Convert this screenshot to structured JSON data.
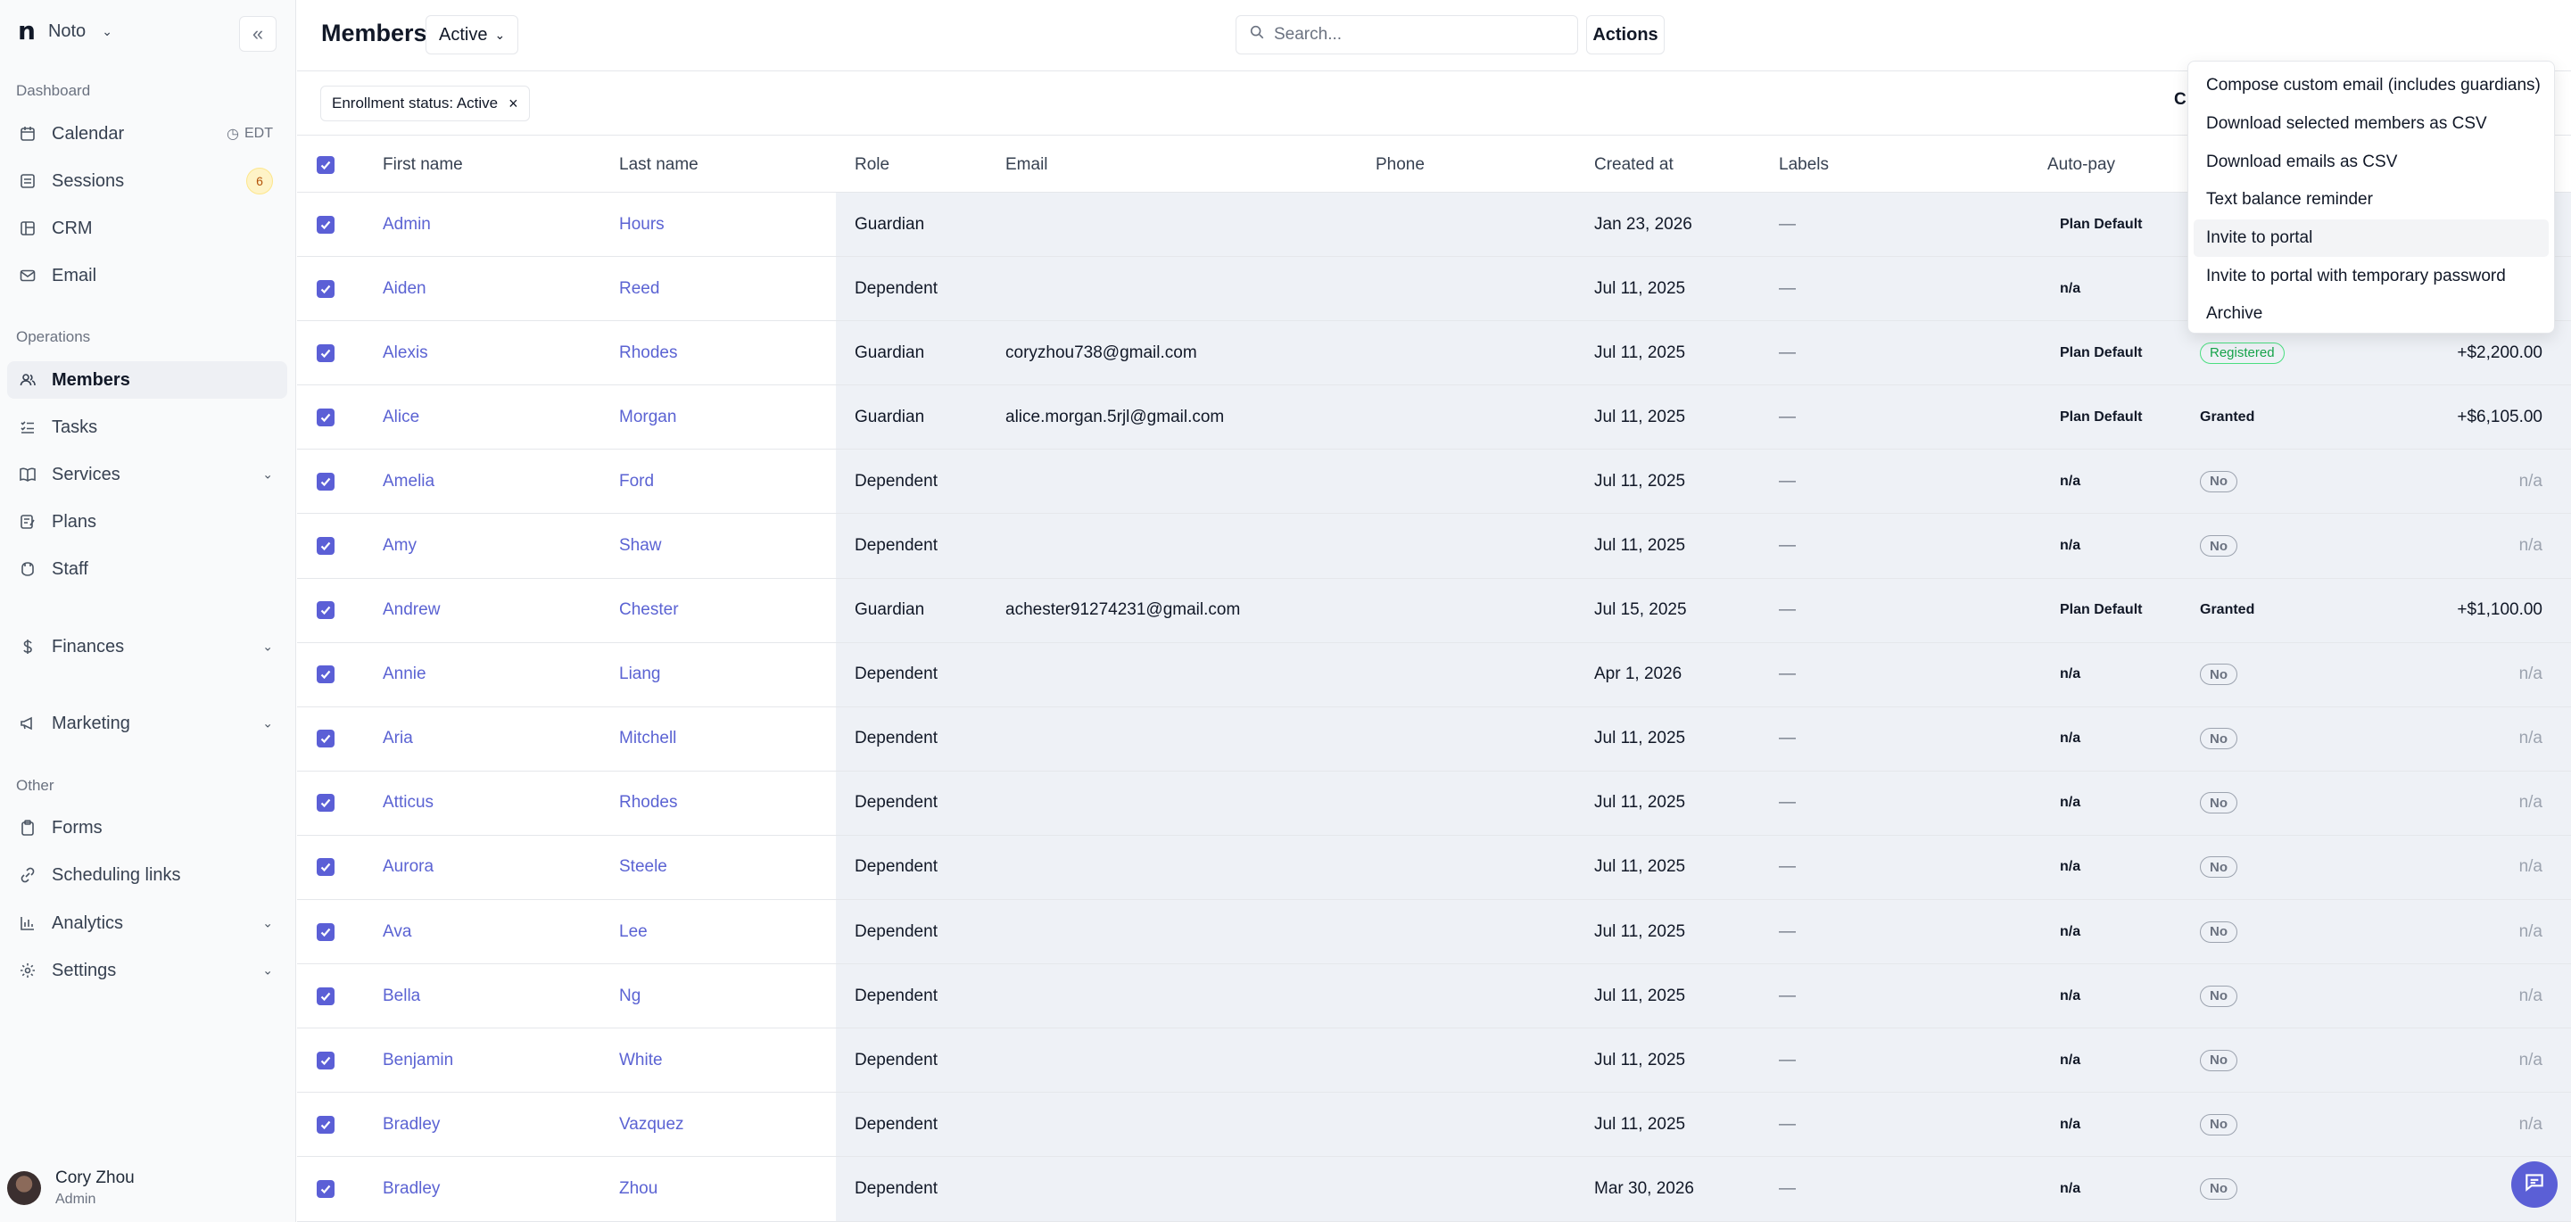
{
  "brand": {
    "logo": "n",
    "name": "Noto"
  },
  "sidebar": {
    "sections": [
      {
        "label": "Dashboard"
      },
      {
        "label": "Operations"
      },
      {
        "label": "Other"
      }
    ],
    "items": [
      {
        "label": "Calendar",
        "icon": "calendar-icon",
        "trail": "EDT"
      },
      {
        "label": "Sessions",
        "icon": "sessions-icon",
        "badge": "6"
      },
      {
        "label": "CRM",
        "icon": "crm-icon"
      },
      {
        "label": "Email",
        "icon": "mail-icon"
      },
      {
        "label": "Members",
        "icon": "users-icon",
        "active": true
      },
      {
        "label": "Tasks",
        "icon": "tasks-icon"
      },
      {
        "label": "Services",
        "icon": "book-icon",
        "expandable": true
      },
      {
        "label": "Plans",
        "icon": "plans-icon"
      },
      {
        "label": "Staff",
        "icon": "staff-icon"
      },
      {
        "label": "Finances",
        "icon": "dollar-icon",
        "expandable": true
      },
      {
        "label": "Marketing",
        "icon": "megaphone-icon",
        "expandable": true
      },
      {
        "label": "Forms",
        "icon": "clipboard-icon"
      },
      {
        "label": "Scheduling links",
        "icon": "link-icon"
      },
      {
        "label": "Analytics",
        "icon": "chart-icon",
        "expandable": true
      },
      {
        "label": "Settings",
        "icon": "gear-icon",
        "expandable": true
      }
    ],
    "user": {
      "name": "Cory Zhou",
      "role": "Admin"
    }
  },
  "header": {
    "title": "Members",
    "status_value": "Active",
    "search_placeholder": "Search...",
    "actions_label": "Actions"
  },
  "filter": {
    "chip": "Enrollment status: Active",
    "clear_label": "Cl"
  },
  "table": {
    "columns": [
      "First name",
      "Last name",
      "Role",
      "Email",
      "Phone",
      "Created at",
      "Labels",
      "Auto-pay"
    ],
    "rows": [
      {
        "first": "Admin",
        "last": "Hours",
        "role": "Guardian",
        "email": "",
        "phone": "",
        "created": "Jan 23, 2026",
        "labels": "—",
        "autopay": "Plan Default",
        "status": "",
        "balance": ""
      },
      {
        "first": "Aiden",
        "last": "Reed",
        "role": "Dependent",
        "email": "",
        "phone": "",
        "created": "Jul 11, 2025",
        "labels": "—",
        "autopay": "n/a",
        "status": "",
        "balance": ""
      },
      {
        "first": "Alexis",
        "last": "Rhodes",
        "role": "Guardian",
        "email": "coryzhou738@gmail.com",
        "phone": "",
        "created": "Jul 11, 2025",
        "labels": "—",
        "autopay": "Plan Default",
        "status": "Registered",
        "balance": "+$2,200.00"
      },
      {
        "first": "Alice",
        "last": "Morgan",
        "role": "Guardian",
        "email": "alice.morgan.5rjl@gmail.com",
        "phone": "",
        "created": "Jul 11, 2025",
        "labels": "—",
        "autopay": "Plan Default",
        "status": "Granted",
        "balance": "+$6,105.00"
      },
      {
        "first": "Amelia",
        "last": "Ford",
        "role": "Dependent",
        "email": "",
        "phone": "",
        "created": "Jul 11, 2025",
        "labels": "—",
        "autopay": "n/a",
        "status": "No",
        "balance": "n/a"
      },
      {
        "first": "Amy",
        "last": "Shaw",
        "role": "Dependent",
        "email": "",
        "phone": "",
        "created": "Jul 11, 2025",
        "labels": "—",
        "autopay": "n/a",
        "status": "No",
        "balance": "n/a"
      },
      {
        "first": "Andrew",
        "last": "Chester",
        "role": "Guardian",
        "email": "achester91274231@gmail.com",
        "phone": "",
        "created": "Jul 15, 2025",
        "labels": "—",
        "autopay": "Plan Default",
        "status": "Granted",
        "balance": "+$1,100.00"
      },
      {
        "first": "Annie",
        "last": "Liang",
        "role": "Dependent",
        "email": "",
        "phone": "",
        "created": "Apr 1, 2026",
        "labels": "—",
        "autopay": "n/a",
        "status": "No",
        "balance": "n/a"
      },
      {
        "first": "Aria",
        "last": "Mitchell",
        "role": "Dependent",
        "email": "",
        "phone": "",
        "created": "Jul 11, 2025",
        "labels": "—",
        "autopay": "n/a",
        "status": "No",
        "balance": "n/a"
      },
      {
        "first": "Atticus",
        "last": "Rhodes",
        "role": "Dependent",
        "email": "",
        "phone": "",
        "created": "Jul 11, 2025",
        "labels": "—",
        "autopay": "n/a",
        "status": "No",
        "balance": "n/a"
      },
      {
        "first": "Aurora",
        "last": "Steele",
        "role": "Dependent",
        "email": "",
        "phone": "",
        "created": "Jul 11, 2025",
        "labels": "—",
        "autopay": "n/a",
        "status": "No",
        "balance": "n/a"
      },
      {
        "first": "Ava",
        "last": "Lee",
        "role": "Dependent",
        "email": "",
        "phone": "",
        "created": "Jul 11, 2025",
        "labels": "—",
        "autopay": "n/a",
        "status": "No",
        "balance": "n/a"
      },
      {
        "first": "Bella",
        "last": "Ng",
        "role": "Dependent",
        "email": "",
        "phone": "",
        "created": "Jul 11, 2025",
        "labels": "—",
        "autopay": "n/a",
        "status": "No",
        "balance": "n/a"
      },
      {
        "first": "Benjamin",
        "last": "White",
        "role": "Dependent",
        "email": "",
        "phone": "",
        "created": "Jul 11, 2025",
        "labels": "—",
        "autopay": "n/a",
        "status": "No",
        "balance": "n/a"
      },
      {
        "first": "Bradley",
        "last": "Vazquez",
        "role": "Dependent",
        "email": "",
        "phone": "",
        "created": "Jul 11, 2025",
        "labels": "—",
        "autopay": "n/a",
        "status": "No",
        "balance": "n/a"
      },
      {
        "first": "Bradley",
        "last": "Zhou",
        "role": "Dependent",
        "email": "",
        "phone": "",
        "created": "Mar 30, 2026",
        "labels": "—",
        "autopay": "n/a",
        "status": "No",
        "balance": "n/a"
      }
    ]
  },
  "actions_menu": {
    "items": [
      "Compose custom email (includes guardians)",
      "Download selected members as CSV",
      "Download emails as CSV",
      "Text balance reminder",
      "Invite to portal",
      "Invite to portal with temporary password",
      "Archive"
    ],
    "hovered": "Invite to portal"
  },
  "colors": {
    "accent": "#5b5fd6",
    "link": "#5b63d3",
    "registered": "#16a34a"
  }
}
